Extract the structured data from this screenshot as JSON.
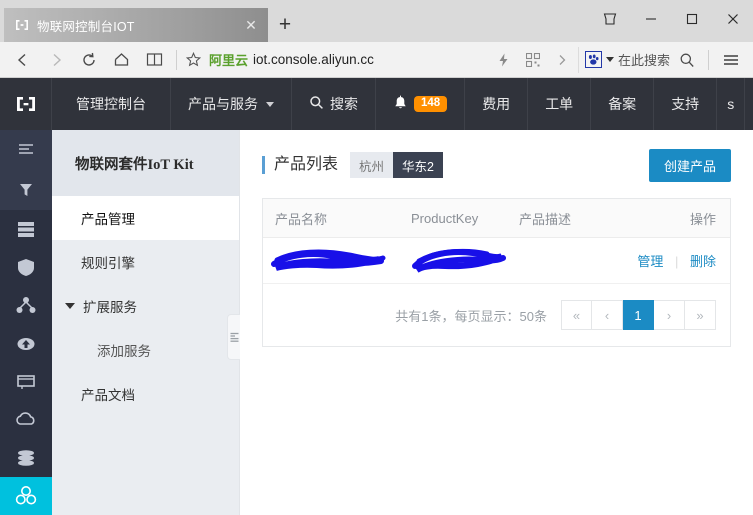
{
  "browser": {
    "tab": {
      "favicon": "iot-bracket-icon",
      "title": "物联网控制台IOT",
      "close_label": "✕"
    },
    "new_tab_label": "+",
    "window_controls": {
      "collections": "collections-icon",
      "minimize": "minimize-icon",
      "maximize": "maximize-icon",
      "close": "close-icon"
    },
    "toolbar": {
      "back": "back-arrow-icon",
      "forward": "forward-arrow-icon",
      "reload": "reload-icon",
      "home": "home-icon",
      "reading_list": "book-icon",
      "favorite": "star-icon",
      "site_badge": "阿里云",
      "url": "iot.console.aliyun.cc",
      "flash": "lightning-icon",
      "qrcode": "qrcode-icon",
      "overflow": "chevron-right-icon",
      "search_engine": "baidu-paw-icon",
      "search_placeholder": "在此搜索",
      "find": "search-icon",
      "menu": "hamburger-menu-icon"
    }
  },
  "console": {
    "navbar": {
      "logo": "aliyun-iot-logo",
      "items": [
        {
          "label": "管理控制台",
          "caret": false
        },
        {
          "label": "产品与服务",
          "caret": true
        },
        {
          "label": "搜索",
          "caret": false,
          "icon": "search-icon"
        },
        {
          "label": "",
          "caret": false,
          "icon": "bell-icon",
          "badge": "148"
        },
        {
          "label": "费用",
          "caret": false
        },
        {
          "label": "工单",
          "caret": false
        },
        {
          "label": "备案",
          "caret": false
        },
        {
          "label": "支持",
          "caret": false
        },
        {
          "label": "s",
          "caret": false
        }
      ]
    },
    "rail": {
      "items": [
        "list-icon",
        "filter-icon",
        "server-stack-icon",
        "shield-icon",
        "network-nodes-icon",
        "cloud-data-icon",
        "monitor-icon",
        "cloud-icon",
        "database-icon",
        "iot-cluster-icon"
      ],
      "selected_index": 9
    },
    "sidebar": {
      "title": "物联网套件IoT Kit",
      "items": [
        {
          "label": "产品管理",
          "active": true,
          "arrow": false,
          "sub": false
        },
        {
          "label": "规则引擎",
          "active": false,
          "arrow": false,
          "sub": false
        },
        {
          "label": "扩展服务",
          "active": false,
          "arrow": true,
          "sub": false
        },
        {
          "label": "添加服务",
          "active": false,
          "arrow": false,
          "sub": true
        },
        {
          "label": "产品文档",
          "active": false,
          "arrow": false,
          "sub": false
        }
      ],
      "collapse_handle": "collapse-sidebar-icon"
    },
    "main": {
      "page_title": "产品列表",
      "regions": [
        {
          "label": "杭州",
          "active": false
        },
        {
          "label": "华东2",
          "active": true
        }
      ],
      "create_button": "创建产品",
      "table": {
        "columns": [
          "产品名称",
          "ProductKey",
          "产品描述",
          "操作"
        ],
        "rows": [
          {
            "name": "",
            "product_key": "",
            "description": "",
            "actions": [
              "管理",
              "删除"
            ],
            "redacted": true
          }
        ]
      },
      "pagination": {
        "info": "共有1条，每页显示：50条",
        "first": "«",
        "prev": "‹",
        "pages": [
          "1"
        ],
        "current": "1",
        "next": "›",
        "last": "»"
      }
    }
  },
  "colors": {
    "navbar_bg": "#30333b",
    "rail_bg": "#2b3040",
    "rail_selected": "#00c1de",
    "sidebar_bg": "#eaedf1",
    "accent": "#1b8bc4",
    "badge_orange": "#ff9000",
    "region_active": "#3b4252",
    "redaction": "#1810e8"
  }
}
